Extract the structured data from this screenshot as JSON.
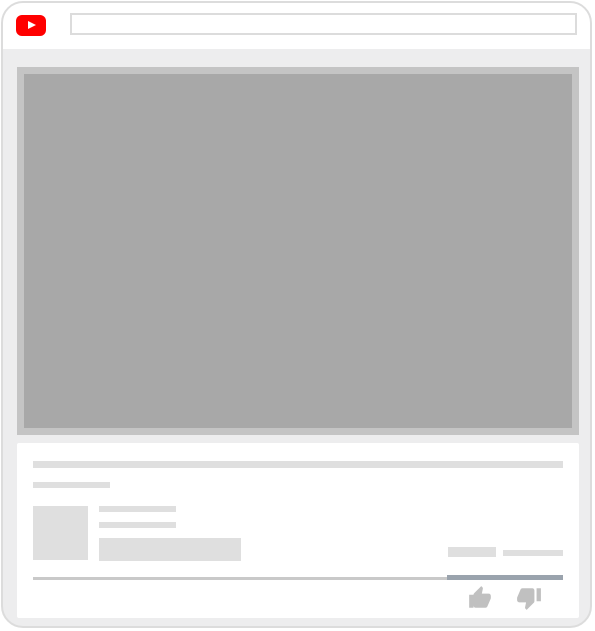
{
  "header": {
    "logo_icon": "youtube-play-icon",
    "logo_color": "#ff0000"
  },
  "search": {
    "value": "",
    "placeholder": ""
  },
  "video": {
    "placeholder_color": "#a8a8a8"
  },
  "actions": {
    "like_icon": "thumbs-up-icon",
    "dislike_icon": "thumbs-down-icon",
    "icon_color": "#c0c0c0"
  }
}
